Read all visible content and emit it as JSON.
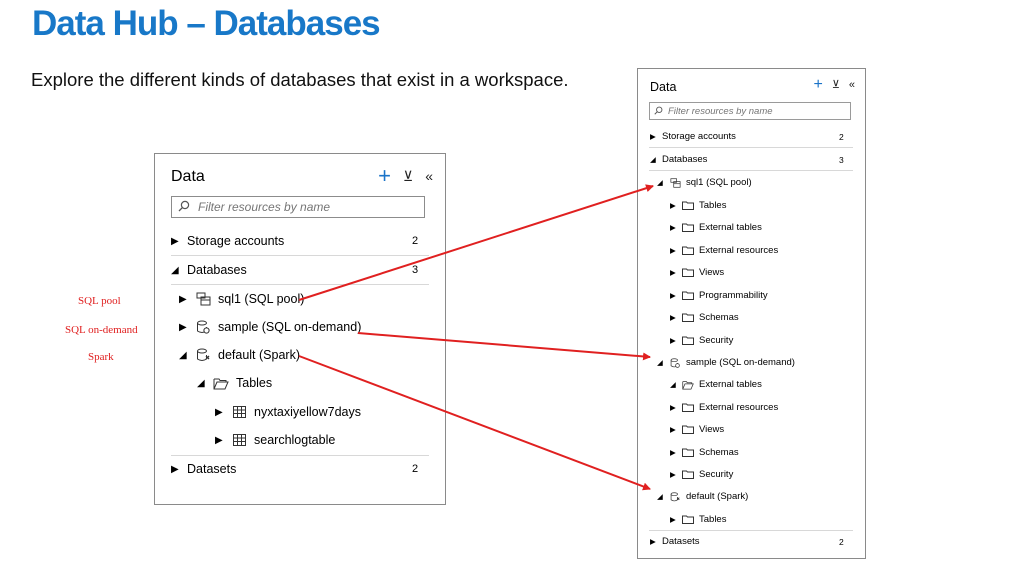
{
  "slide": {
    "title": "Data Hub – Databases",
    "subtitle": "Explore the different kinds of databases that exist in a workspace."
  },
  "labels": {
    "sql_pool": "SQL pool",
    "sql_on_demand": "SQL on-demand",
    "spark": "Spark"
  },
  "left_panel": {
    "header": "Data",
    "search_placeholder": "Filter resources by name",
    "storage_accounts": "Storage accounts",
    "storage_count": "2",
    "databases": "Databases",
    "databases_count": "3",
    "sql1": "sql1 (SQL pool)",
    "sample": "sample (SQL on-demand)",
    "default": "default (Spark)",
    "tables": "Tables",
    "table1": "nyxtaxiyellow7days",
    "table2": "searchlogtable",
    "datasets": "Datasets",
    "datasets_count": "2"
  },
  "right_panel": {
    "header": "Data",
    "search_placeholder": "Filter resources by name",
    "storage_accounts": "Storage accounts",
    "storage_count": "2",
    "databases": "Databases",
    "databases_count": "3",
    "sql1": "sql1 (SQL pool)",
    "sql1_children": [
      "Tables",
      "External tables",
      "External resources",
      "Views",
      "Programmability",
      "Schemas",
      "Security"
    ],
    "sample": "sample (SQL on-demand)",
    "sample_children": [
      "External tables",
      "External resources",
      "Views",
      "Schemas",
      "Security"
    ],
    "default": "default (Spark)",
    "default_children": [
      "Tables"
    ],
    "datasets": "Datasets",
    "datasets_count": "2"
  },
  "colors": {
    "title": "#1878c8",
    "accent": "#1a73c8",
    "arrow": "#e02020"
  }
}
